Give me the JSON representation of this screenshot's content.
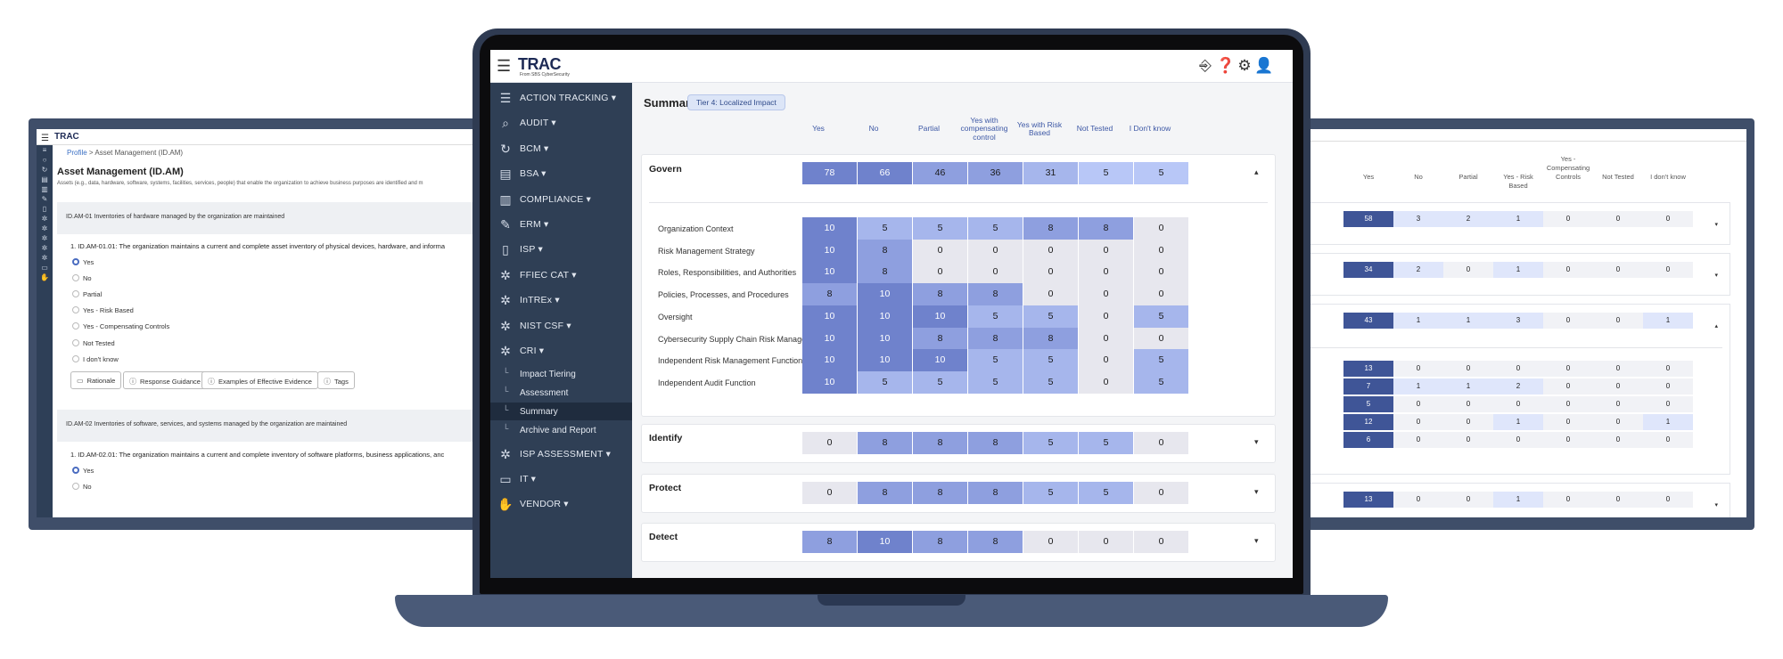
{
  "left_screen": {
    "logo": "TRAC",
    "breadcrumb": {
      "home": "Profile",
      "separator": ">",
      "current": "Asset Management (ID.AM)"
    },
    "title": "Asset Management (ID.AM)",
    "subtitle": "Assets (e.g., data, hardware, software, systems, facilities, services, people) that enable the organization to achieve business purposes are identified and m",
    "sections": [
      {
        "band": "ID.AM-01   Inventories of hardware managed by the organization are maintained",
        "question": "1.  ID.AM-01.01: The organization maintains a current and complete asset inventory of physical devices, hardware, and informa",
        "options": [
          "Yes",
          "No",
          "Partial",
          "Yes - Risk Based",
          "Yes - Compensating Controls",
          "Not Tested",
          "I don't know"
        ],
        "selected": "Yes",
        "buttons": [
          "Rationale",
          "Response Guidance",
          "Examples of Effective Evidence",
          "Tags"
        ]
      },
      {
        "band": "ID.AM-02   Inventories of software, services, and systems managed by the organization are maintained",
        "question": "1.  ID.AM-02.01: The organization maintains a current and complete inventory of software platforms, business applications, anc",
        "options": [
          "Yes",
          "No"
        ],
        "selected": "Yes"
      }
    ]
  },
  "right_screen": {
    "columns": [
      "Yes",
      "No",
      "Partial",
      "Yes - Risk Based",
      "Yes - Compensating Controls",
      "Not Tested",
      "I don't know"
    ],
    "rows": [
      [
        "58",
        "3",
        "2",
        "1",
        "0",
        "0",
        "0"
      ],
      [
        "34",
        "2",
        "0",
        "1",
        "0",
        "0",
        "0"
      ],
      [
        "43",
        "1",
        "1",
        "3",
        "0",
        "0",
        "1"
      ],
      [
        "13",
        "0",
        "0",
        "0",
        "0",
        "0",
        "0"
      ],
      [
        "7",
        "1",
        "1",
        "2",
        "0",
        "0",
        "0"
      ],
      [
        "5",
        "0",
        "0",
        "0",
        "0",
        "0",
        "0"
      ],
      [
        "12",
        "0",
        "0",
        "1",
        "0",
        "0",
        "1"
      ],
      [
        "6",
        "0",
        "0",
        "0",
        "0",
        "0",
        "0"
      ],
      [
        "13",
        "0",
        "0",
        "1",
        "0",
        "0",
        "0"
      ]
    ]
  },
  "app": {
    "brand": "TRAC",
    "brand_sub": "From SBS CyberSecurity",
    "nav": [
      {
        "label": "ACTION TRACKING",
        "icon": "list-icon"
      },
      {
        "label": "AUDIT",
        "icon": "magnifier-icon"
      },
      {
        "label": "BCM",
        "icon": "refresh-icon"
      },
      {
        "label": "BSA",
        "icon": "documents-icon"
      },
      {
        "label": "COMPLIANCE",
        "icon": "building-icon"
      },
      {
        "label": "ERM",
        "icon": "pencil-doc-icon"
      },
      {
        "label": "ISP",
        "icon": "document-icon"
      },
      {
        "label": "FFIEC CAT",
        "icon": "network-icon"
      },
      {
        "label": "InTREx",
        "icon": "network-icon"
      },
      {
        "label": "NIST CSF",
        "icon": "network-icon"
      },
      {
        "label": "CRI",
        "icon": "network-icon"
      },
      {
        "label": "ISP ASSESSMENT",
        "icon": "network-icon"
      },
      {
        "label": "IT",
        "icon": "monitor-icon"
      },
      {
        "label": "VENDOR",
        "icon": "handshake-icon"
      }
    ],
    "cri_sub": [
      "Impact Tiering",
      "Assessment",
      "Summary",
      "Archive and Report"
    ],
    "active_sub": "Summary"
  },
  "summary": {
    "title": "Summary",
    "tier": "Tier 4: Localized Impact",
    "columns": [
      "Yes",
      "No",
      "Partial",
      "Yes with compensating control",
      "Yes with Risk Based",
      "Not Tested",
      "I Don't know"
    ],
    "govern": {
      "name": "Govern",
      "totals": [
        "78",
        "66",
        "46",
        "36",
        "31",
        "5",
        "5"
      ],
      "subs": [
        {
          "name": "Organization Context",
          "values": [
            "10",
            "5",
            "5",
            "5",
            "8",
            "8",
            "0"
          ]
        },
        {
          "name": "Risk Management Strategy",
          "values": [
            "10",
            "8",
            "0",
            "0",
            "0",
            "0",
            "0"
          ]
        },
        {
          "name": "Roles, Responsibilities, and Authorities",
          "values": [
            "10",
            "8",
            "0",
            "0",
            "0",
            "0",
            "0"
          ]
        },
        {
          "name": "Policies, Processes, and Procedures",
          "values": [
            "8",
            "10",
            "8",
            "8",
            "0",
            "0",
            "0"
          ]
        },
        {
          "name": "Oversight",
          "values": [
            "10",
            "10",
            "10",
            "5",
            "5",
            "0",
            "5"
          ]
        },
        {
          "name": "Cybersecurity Supply Chain Risk Management",
          "values": [
            "10",
            "10",
            "8",
            "8",
            "8",
            "0",
            "0"
          ]
        },
        {
          "name": "Independent Risk Management Function",
          "values": [
            "10",
            "10",
            "10",
            "5",
            "5",
            "0",
            "5"
          ]
        },
        {
          "name": "Independent Audit Function",
          "values": [
            "10",
            "5",
            "5",
            "5",
            "5",
            "0",
            "5"
          ]
        }
      ]
    },
    "others": [
      {
        "name": "Identify",
        "totals": [
          "0",
          "8",
          "8",
          "8",
          "5",
          "5",
          "0"
        ]
      },
      {
        "name": "Protect",
        "totals": [
          "0",
          "8",
          "8",
          "8",
          "5",
          "5",
          "0"
        ]
      },
      {
        "name": "Detect",
        "totals": [
          "8",
          "10",
          "8",
          "8",
          "0",
          "0",
          "0"
        ]
      }
    ]
  }
}
